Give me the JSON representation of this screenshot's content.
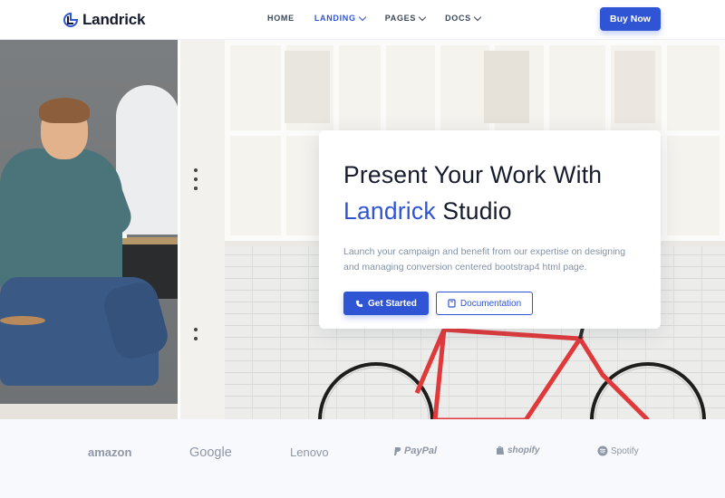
{
  "header": {
    "brand": "Landrick",
    "nav": [
      {
        "label": "HOME",
        "active": false,
        "dropdown": false
      },
      {
        "label": "LANDING",
        "active": true,
        "dropdown": true
      },
      {
        "label": "PAGES",
        "active": false,
        "dropdown": true
      },
      {
        "label": "DOCS",
        "active": false,
        "dropdown": true
      }
    ],
    "cta": "Buy Now"
  },
  "hero": {
    "title_line1": "Present Your Work With",
    "title_accent": "Landrick",
    "title_rest": " Studio",
    "description": "Launch your campaign and benefit from our expertise on designing and managing conversion centered bootstrap4 html page.",
    "primary_button": "Get Started",
    "secondary_button": "Documentation"
  },
  "brands": [
    "amazon",
    "Google",
    "Lenovo",
    "PayPal",
    "shopify",
    "Spotify"
  ],
  "colors": {
    "primary": "#2f55d4",
    "heading": "#161c2d",
    "muted": "#8492a6",
    "brand_gray": "#8e97a6"
  }
}
